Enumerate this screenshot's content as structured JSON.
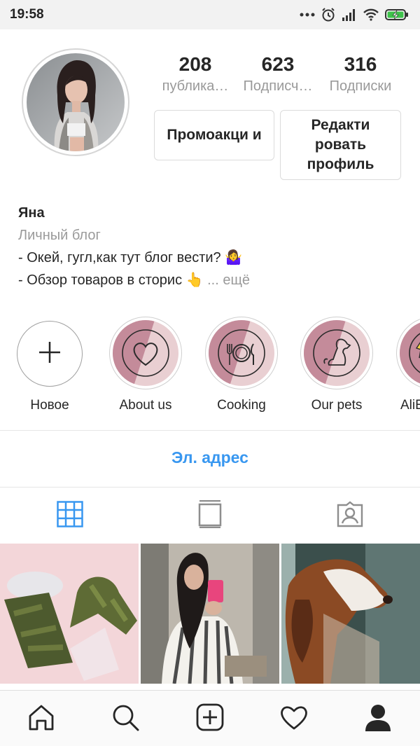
{
  "status_bar": {
    "time": "19:58",
    "icons": [
      "more-dots-icon",
      "alarm-icon",
      "signal-icon",
      "wifi-icon",
      "battery-charging-icon"
    ]
  },
  "profile": {
    "stats": [
      {
        "value": "208",
        "label": "публика…"
      },
      {
        "value": "623",
        "label": "Подписч…"
      },
      {
        "value": "316",
        "label": "Подписки"
      }
    ],
    "promo_button": "Промоакци и",
    "edit_button": "Редакти ровать профиль"
  },
  "bio": {
    "name": "Яна",
    "category": "Личный блог",
    "line1": "- Окей, гугл,как тут блог вести? 🤷‍♀️",
    "line2": "- Обзор товаров в сторис 👆",
    "more": "... ещё"
  },
  "highlights": [
    {
      "label": "Новое",
      "icon": "plus-icon"
    },
    {
      "label": "About us",
      "icon": "heart-icon"
    },
    {
      "label": "Cooking",
      "icon": "plate-cutlery-icon"
    },
    {
      "label": "Our pets",
      "icon": "dog-icon"
    },
    {
      "label": "AliE",
      "icon": "lightning-icon"
    }
  ],
  "email_button": "Эл. адрес",
  "tabs": [
    {
      "icon": "grid-icon",
      "active": true
    },
    {
      "icon": "feed-icon",
      "active": false
    },
    {
      "icon": "tagged-icon",
      "active": false
    }
  ],
  "bottom_nav": [
    "home-icon",
    "search-icon",
    "add-post-icon",
    "heart-icon",
    "profile-icon"
  ],
  "colors": {
    "accent": "#3897f0",
    "text": "#262626",
    "muted": "#999999",
    "highlight_pink": "#c98a98"
  }
}
